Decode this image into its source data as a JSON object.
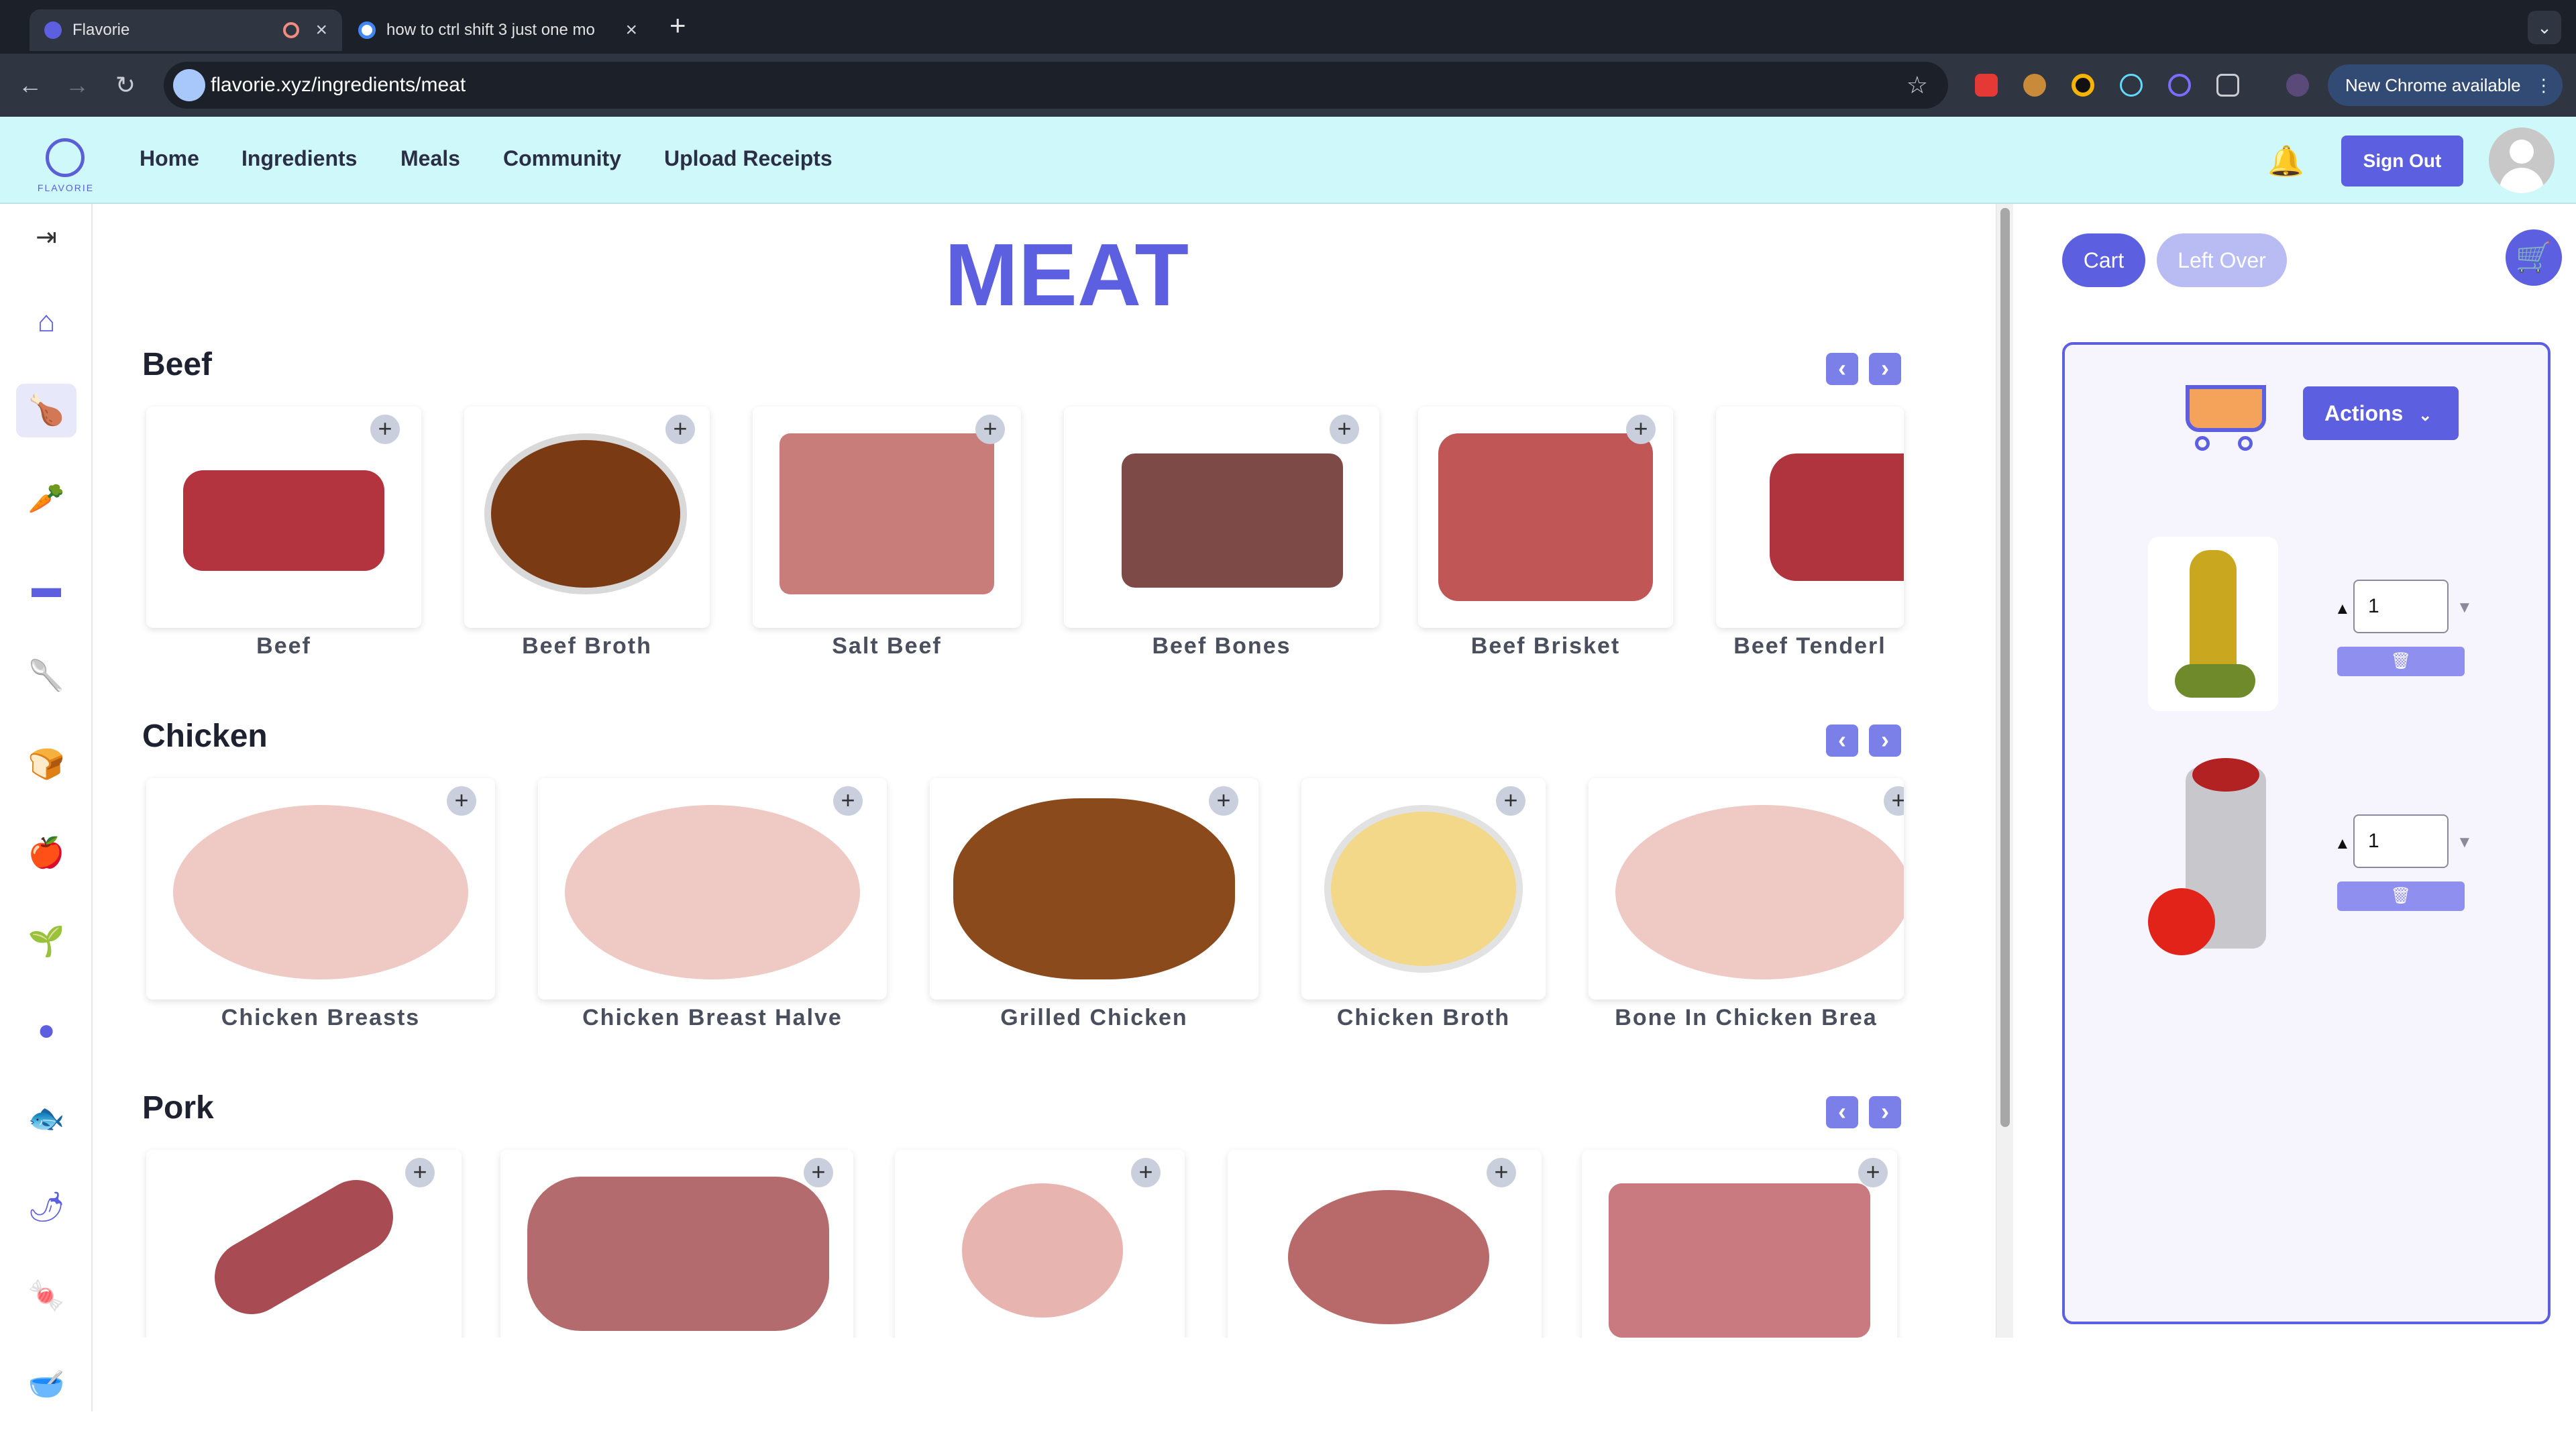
{
  "browser": {
    "tabs": [
      {
        "title": "Flavorie"
      },
      {
        "title": "how to ctrl shift 3 just one mo"
      }
    ],
    "url": "flavorie.xyz/ingredients/meat",
    "new_chrome": "New Chrome available"
  },
  "header": {
    "logo_text": "FLAVORIE",
    "nav": [
      "Home",
      "Ingredients",
      "Meals",
      "Community",
      "Upload Receipts"
    ],
    "sign_out": "Sign Out"
  },
  "page": {
    "title": "MEAT",
    "sections": [
      {
        "title": "Beef",
        "items": [
          "Beef",
          "Beef Broth",
          "Salt Beef",
          "Beef Bones",
          "Beef Brisket",
          "Beef Tenderl"
        ]
      },
      {
        "title": "Chicken",
        "items": [
          "Chicken Breasts",
          "Chicken Breast Halve",
          "Grilled Chicken",
          "Chicken Broth",
          "Bone In Chicken Brea"
        ]
      },
      {
        "title": "Pork",
        "items": []
      }
    ]
  },
  "cart_panel": {
    "cart_button": "Cart",
    "leftover_button": "Left Over",
    "actions_button": "Actions",
    "items": [
      {
        "qty": "1"
      },
      {
        "qty": "1"
      }
    ]
  },
  "colors": {
    "accent": "#5b5fe0",
    "header_bg": "#cff8fb",
    "browser_dark": "#1c2129"
  }
}
